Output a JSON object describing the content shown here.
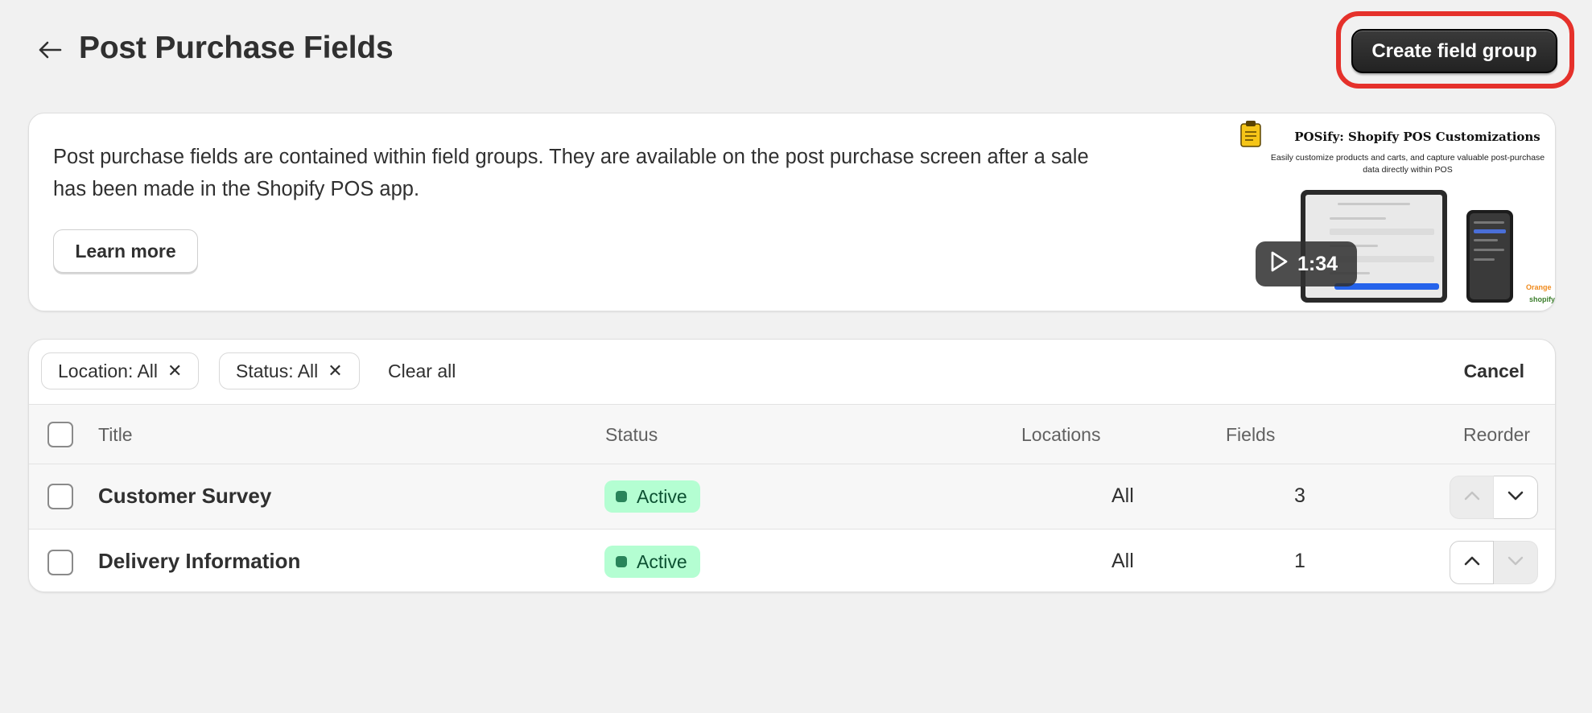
{
  "header": {
    "title": "Post Purchase Fields",
    "create_button": "Create field group"
  },
  "info_card": {
    "description": "Post purchase fields are contained within field groups. They are available on the post purchase screen after a sale has been made in the Shopify POS app.",
    "learn_more": "Learn more",
    "video": {
      "title": "POSify: Shopify POS Customizations",
      "subtitle": "Easily customize products and carts, and capture valuable post-purchase data directly within POS",
      "duration": "1:34",
      "brand_orange": "Orange",
      "brand_shopify": "shopify"
    }
  },
  "filters": {
    "location": "Location: All",
    "status": "Status: All",
    "clear_all": "Clear all",
    "cancel": "Cancel"
  },
  "table": {
    "columns": {
      "title": "Title",
      "status": "Status",
      "locations": "Locations",
      "fields": "Fields",
      "reorder": "Reorder"
    },
    "rows": [
      {
        "title": "Customer Survey",
        "status": "Active",
        "locations": "All",
        "fields": "3"
      },
      {
        "title": "Delivery Information",
        "status": "Active",
        "locations": "All",
        "fields": "1"
      }
    ]
  },
  "colors": {
    "highlight": "#e5312b",
    "primary_button": "#303030",
    "badge_bg": "#b4fed2",
    "badge_text": "#0c5132"
  }
}
